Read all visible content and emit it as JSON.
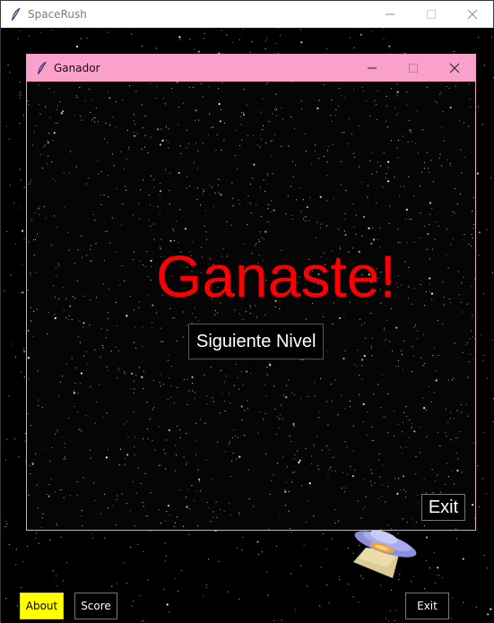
{
  "main_window": {
    "title": "SpaceRush",
    "controls": [
      "minimize",
      "maximize",
      "close"
    ]
  },
  "dialog": {
    "title": "Ganador",
    "win_message": "Ganaste!",
    "next_level_label": "Siguiente Nivel",
    "exit_label": "Exit"
  },
  "bottom_bar": {
    "about_label": "About",
    "score_label": "Score",
    "exit_label": "Exit"
  },
  "colors": {
    "dialog_titlebar": "#f9a0cb",
    "win_message": "#ff0000",
    "about_button": "#ffff00"
  },
  "icons": [
    "feather-icon",
    "minimize-icon",
    "maximize-icon",
    "close-icon",
    "spaceship-icon"
  ]
}
